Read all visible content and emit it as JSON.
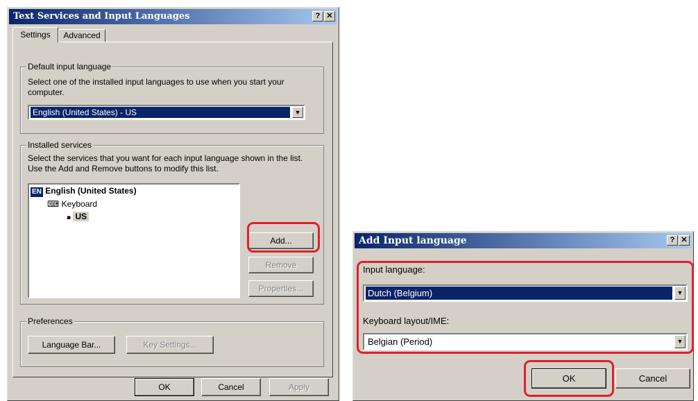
{
  "main_dialog": {
    "title": "Text Services and Input Languages",
    "help_button": "?",
    "close_button": "✕",
    "tabs": [
      {
        "label": "Settings",
        "selected": true
      },
      {
        "label": "Advanced",
        "selected": false
      }
    ],
    "default_language": {
      "legend": "Default input language",
      "description": "Select one of the installed input languages to use when you start your computer.",
      "selected_value": "English (United States) - US"
    },
    "installed_services": {
      "legend": "Installed services",
      "description": "Select the services that you want for each input language shown in the list. Use the Add and Remove buttons to modify this list.",
      "tree": {
        "language_badge": "EN",
        "language": "English (United States)",
        "category": "Keyboard",
        "layout": "US",
        "layout_bullet": "▪"
      },
      "add_button": "Add...",
      "remove_button": "Remove",
      "properties_button": "Properties..."
    },
    "preferences": {
      "legend": "Preferences",
      "language_bar_button": "Language Bar...",
      "key_settings_button": "Key Settings..."
    },
    "ok_button": "OK",
    "cancel_button": "Cancel",
    "apply_button": "Apply"
  },
  "add_dialog": {
    "title": "Add Input language",
    "help_button": "?",
    "close_button": "✕",
    "input_language_label": "Input language:",
    "input_language_value": "Dutch (Belgium)",
    "keyboard_label": "Keyboard layout/IME:",
    "keyboard_value": "Belgian (Period)",
    "ok_button": "OK",
    "cancel_button": "Cancel"
  },
  "icons": {
    "dropdown_arrow": "▼",
    "keyboard_icon": "⌨"
  },
  "colors": {
    "titlebar_start": "#0a246a",
    "titlebar_end": "#a6caf0",
    "dialog_face": "#d4d0c8",
    "highlight_annotation": "#e0202a",
    "selection": "#0a246a"
  }
}
